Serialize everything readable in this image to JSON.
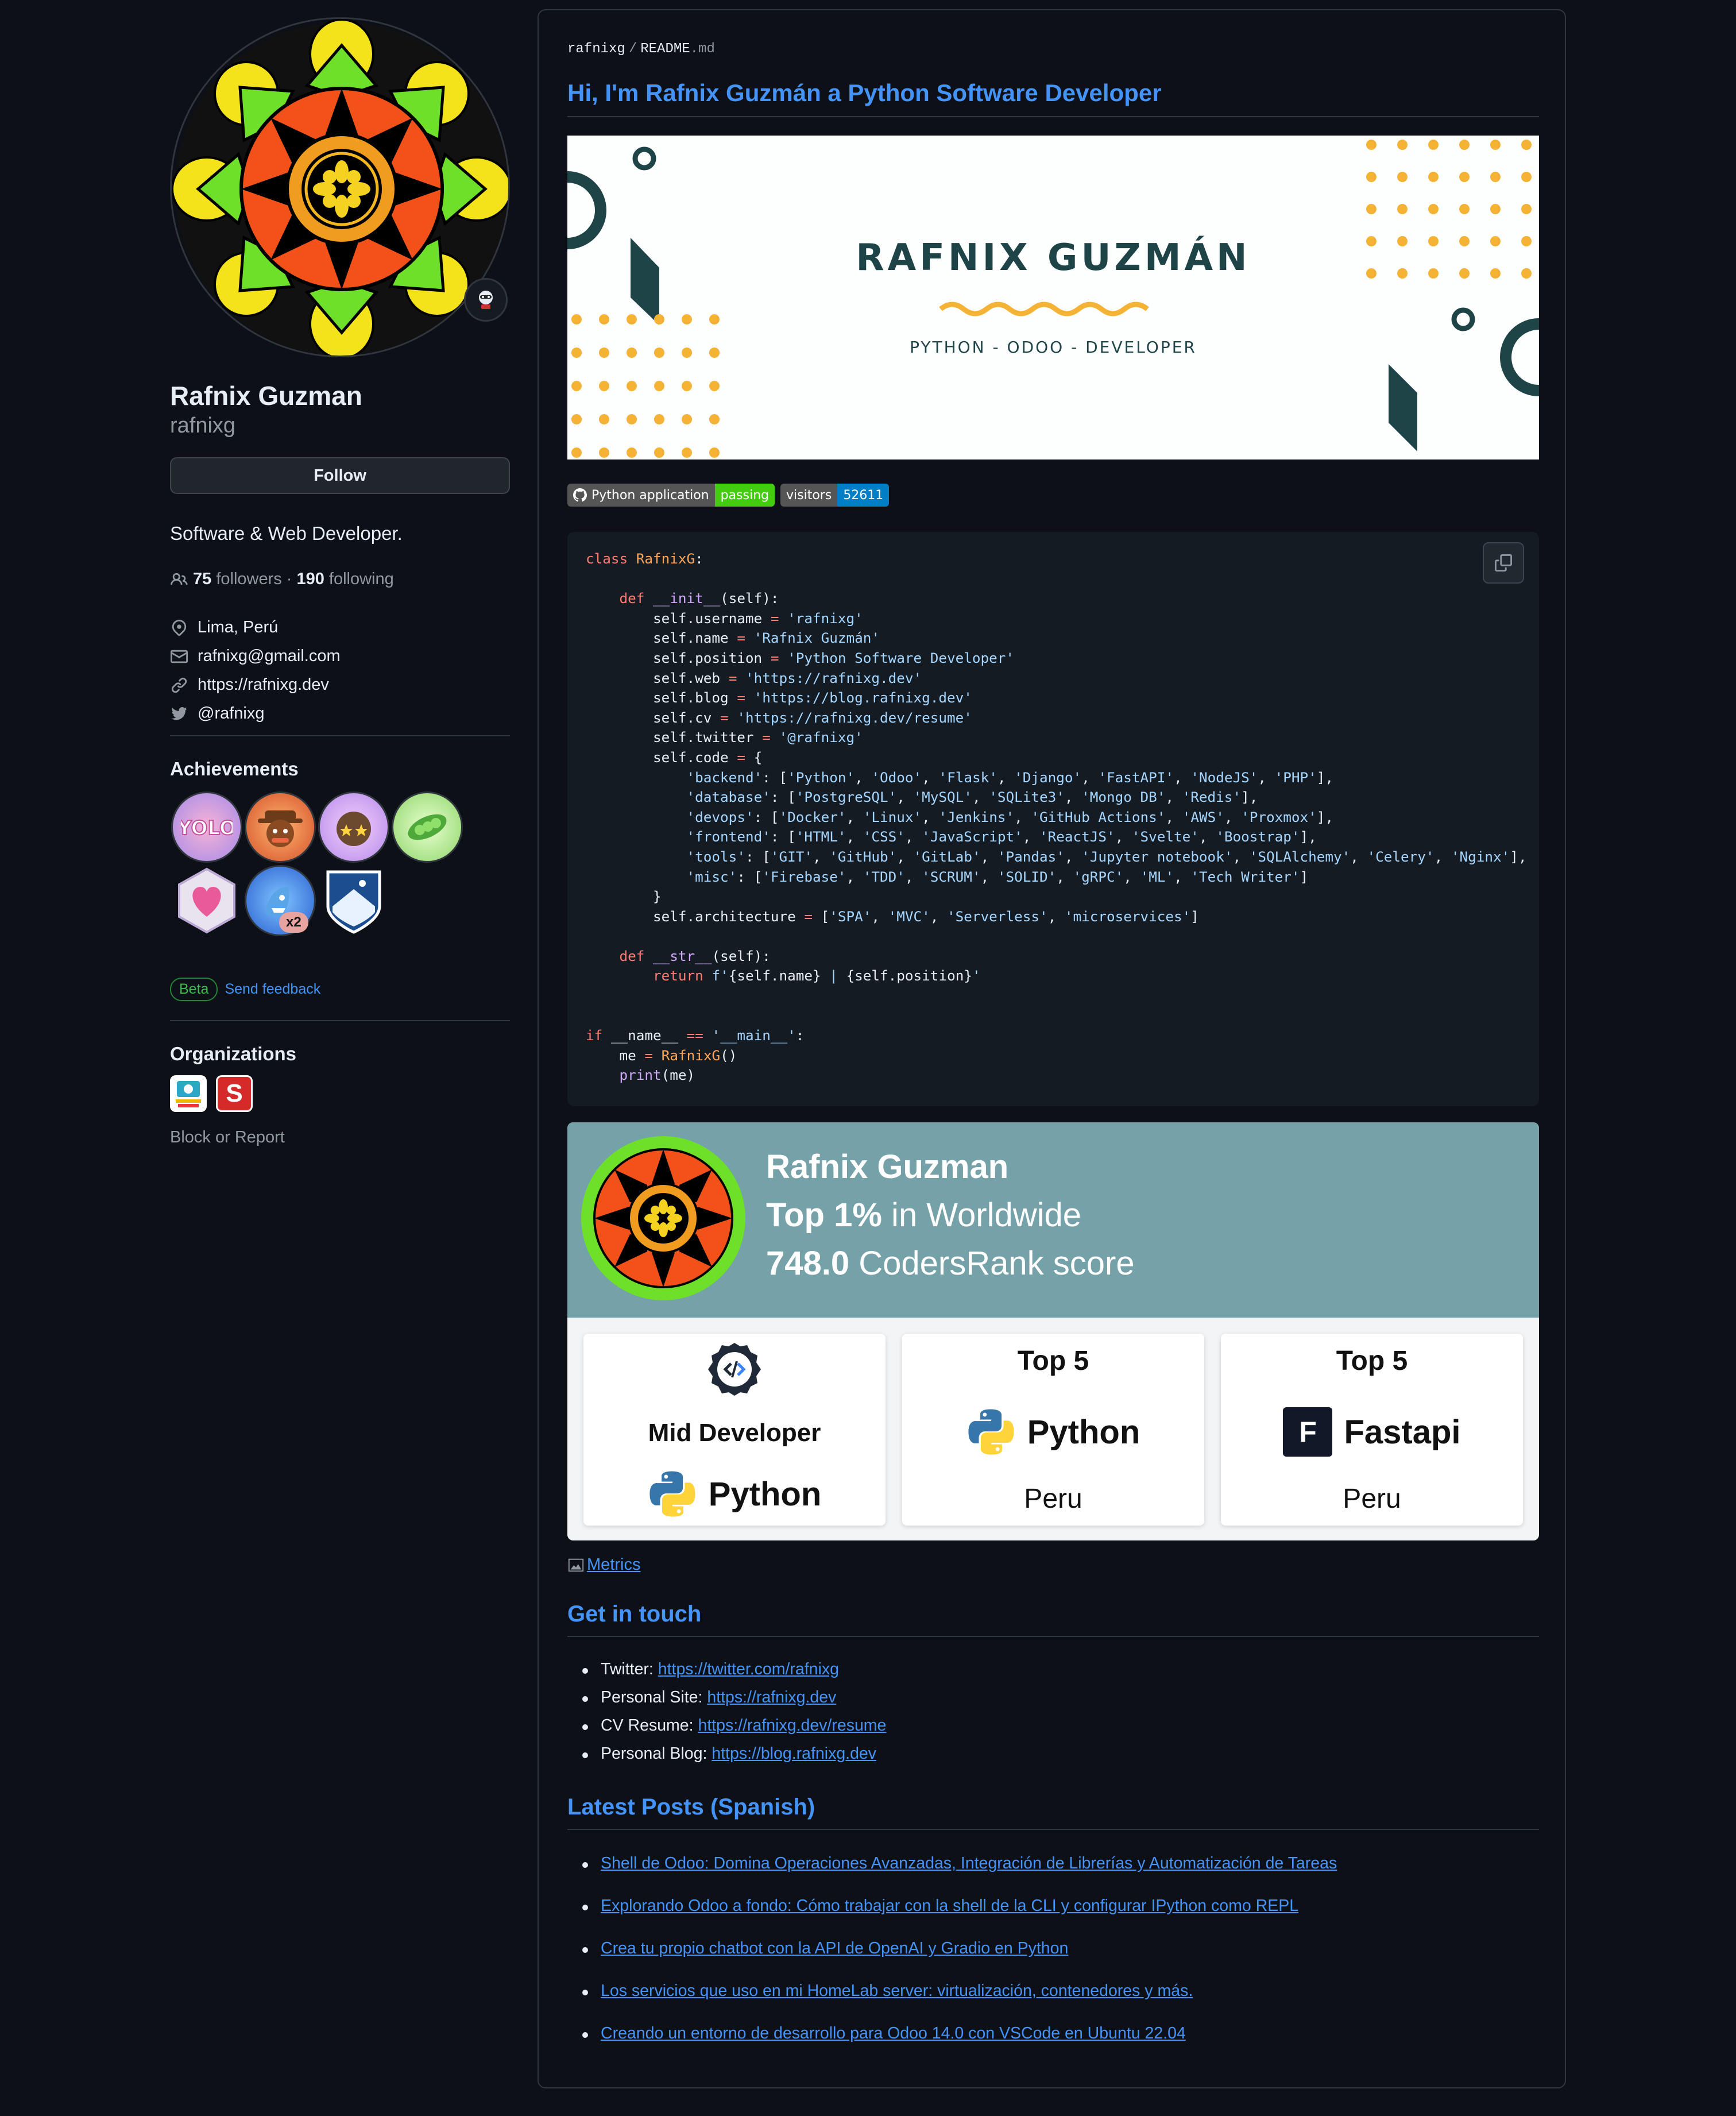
{
  "profile": {
    "name": "Rafnix Guzman",
    "login": "rafnixg",
    "follow_label": "Follow",
    "bio": "Software & Web Developer.",
    "followers_count": "75",
    "followers_label": "followers",
    "dot": "·",
    "following_count": "190",
    "following_label": "following",
    "location": "Lima, Perú",
    "email": "rafnixg@gmail.com",
    "website": "https://rafnixg.dev",
    "twitter": "@rafnixg",
    "achievements_title": "Achievements",
    "achievement_multiplier": "x2",
    "beta_label": "Beta",
    "send_feedback": "Send feedback",
    "organizations_title": "Organizations",
    "org_two_letter": "S",
    "block_report": "Block or Report"
  },
  "readme": {
    "breadcrumb_user": "rafnixg",
    "breadcrumb_sep": "/",
    "breadcrumb_file": "README",
    "breadcrumb_ext": ".md",
    "heading": "Hi, I'm Rafnix Guzmán a Python Software Developer",
    "banner_title": "RAFNIX GUZMÁN",
    "banner_subtitle": "PYTHON - ODOO - DEVELOPER",
    "shield1_label": "Python application",
    "shield1_value": "passing",
    "shield2_label": "visitors",
    "shield2_value": "52611",
    "metrics_alt": "Metrics"
  },
  "codersrank": {
    "name": "Rafnix Guzman",
    "rank_bold": "Top 1%",
    "rank_rest": " in Worldwide",
    "score_bold": "748.0",
    "score_rest": " CodersRank score",
    "card1_title": "Mid Developer",
    "card1_lang": "Python",
    "card2_title": "Top 5",
    "card2_lang": "Python",
    "card2_loc": "Peru",
    "card3_title": "Top 5",
    "card3_icon_letter": "F",
    "card3_lang": "Fastapi",
    "card3_loc": "Peru"
  },
  "contact": {
    "title": "Get in touch",
    "items": [
      {
        "label": "Twitter: ",
        "link": "https://twitter.com/rafnixg"
      },
      {
        "label": "Personal Site: ",
        "link": "https://rafnixg.dev"
      },
      {
        "label": "CV Resume: ",
        "link": "https://rafnixg.dev/resume"
      },
      {
        "label": "Personal Blog: ",
        "link": "https://blog.rafnixg.dev"
      }
    ]
  },
  "posts": {
    "title": "Latest Posts (Spanish)",
    "items": [
      "Shell de Odoo: Domina Operaciones Avanzadas, Integración de Librerías y Automatización de Tareas",
      "Explorando Odoo a fondo: Cómo trabajar con la shell de la CLI y configurar IPython como REPL",
      "Crea tu propio chatbot con la API de OpenAI y Gradio en Python",
      "Los servicios que uso en mi HomeLab server: virtualización, contenedores y más.",
      "Creando un entorno de desarrollo para Odoo 14.0 con VSCode en Ubuntu 22.04"
    ]
  },
  "colors": {
    "background": "#0d1117",
    "link": "#4493f8",
    "border": "#30363d",
    "codersrank_header": "#75a1a8",
    "shield_green": "#4c1",
    "shield_blue": "#007ec6"
  },
  "icons": [
    "people-icon",
    "location-icon",
    "mail-icon",
    "link-icon",
    "twitter-icon",
    "copy-icon",
    "github-icon",
    "python-icon"
  ]
}
